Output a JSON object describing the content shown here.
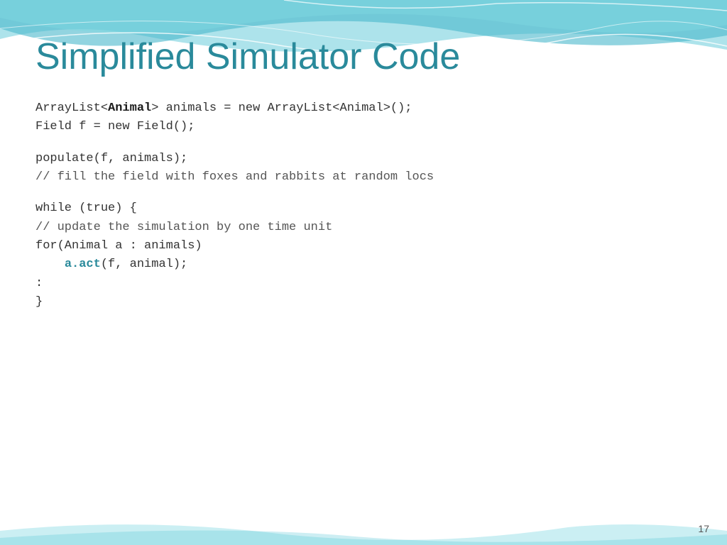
{
  "slide": {
    "title": "Simplified Simulator Code",
    "page_number": "17",
    "code": {
      "line1": "ArrayList<Animal> animals = new ArrayList<Animal>();",
      "line1_part1": "ArrayList<",
      "line1_animal": "Animal",
      "line1_part2": "> animals = new ArrayList<Animal>();",
      "line2": "Field f = new Field();",
      "line3": "populate(f, animals);",
      "line4": "  // fill the field with foxes and rabbits at random locs",
      "line5": "while (true) {",
      "line6": "  // update the simulation by one time unit",
      "line7": "  for(Animal a :  animals)",
      "line8_part1": "    ",
      "line8_method": "a.act",
      "line8_part2": "(f, animal);",
      "line9": "        :",
      "line10": "}"
    }
  }
}
